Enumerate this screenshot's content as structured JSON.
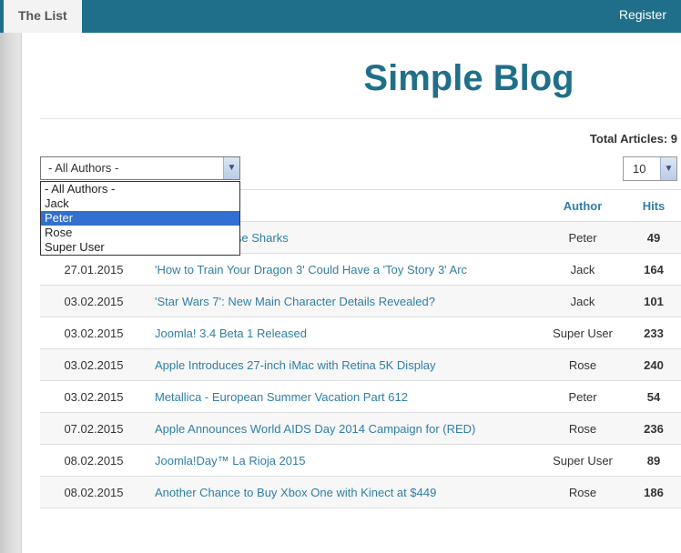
{
  "topbar": {
    "tab_label": "The List",
    "register_label": "Register"
  },
  "site": {
    "title": "Simple Blog"
  },
  "summary": {
    "total_articles_text": "Total Articles: 9"
  },
  "filter": {
    "selected_label": "- All Authors -",
    "options": [
      "- All Authors -",
      "Jack",
      "Peter",
      "Rose",
      "Super User"
    ],
    "highlighted_option": "Peter",
    "limit_value": "10"
  },
  "table": {
    "headers": {
      "date": "",
      "title": "",
      "author": "Author",
      "hits": "Hits"
    },
    "rows": [
      {
        "date": "",
        "title": "with the San Jose Sharks",
        "author": "Peter",
        "hits": "49"
      },
      {
        "date": "27.01.2015",
        "title": "'How to Train Your Dragon 3' Could Have a 'Toy Story 3' Arc",
        "author": "Jack",
        "hits": "164"
      },
      {
        "date": "03.02.2015",
        "title": "'Star Wars 7': New Main Character Details Revealed?",
        "author": "Jack",
        "hits": "101"
      },
      {
        "date": "03.02.2015",
        "title": "Joomla! 3.4 Beta 1 Released",
        "author": "Super User",
        "hits": "233"
      },
      {
        "date": "03.02.2015",
        "title": "Apple Introduces 27-inch iMac with Retina 5K Display",
        "author": "Rose",
        "hits": "240"
      },
      {
        "date": "03.02.2015",
        "title": "Metallica - European Summer Vacation Part 612",
        "author": "Peter",
        "hits": "54"
      },
      {
        "date": "07.02.2015",
        "title": "Apple Announces World AIDS Day 2014 Campaign for (RED)",
        "author": "Rose",
        "hits": "236"
      },
      {
        "date": "08.02.2015",
        "title": "Joomla!Day™ La Rioja 2015",
        "author": "Super User",
        "hits": "89"
      },
      {
        "date": "08.02.2015",
        "title": "Another Chance to Buy Xbox One with Kinect at $449",
        "author": "Rose",
        "hits": "186"
      }
    ]
  }
}
